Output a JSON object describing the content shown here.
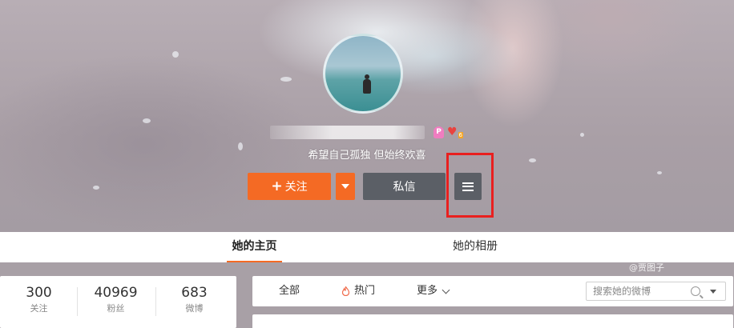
{
  "profile": {
    "bio": "希望自己孤独 但始终欢喜",
    "badge_vip": "P",
    "badge_level": "6"
  },
  "actions": {
    "follow_icon": "+",
    "follow_label": "关注",
    "message_label": "私信",
    "menu_icon": "hamburger-menu-icon"
  },
  "tabs": [
    {
      "label": "她的主页",
      "active": true
    },
    {
      "label": "她的相册",
      "active": false
    }
  ],
  "watermark": "@贾图子",
  "stats": [
    {
      "value": "300",
      "label": "关注"
    },
    {
      "value": "40969",
      "label": "粉丝"
    },
    {
      "value": "683",
      "label": "微博"
    }
  ],
  "feed_filter": {
    "all_label": "全部",
    "hot_label": "热门",
    "more_label": "更多",
    "search_placeholder": "搜索她的微博"
  },
  "colors": {
    "accent": "#f46a24",
    "button_dark": "#5b5f66",
    "highlight": "#e9201f",
    "hot_icon": "#f06a4a"
  }
}
